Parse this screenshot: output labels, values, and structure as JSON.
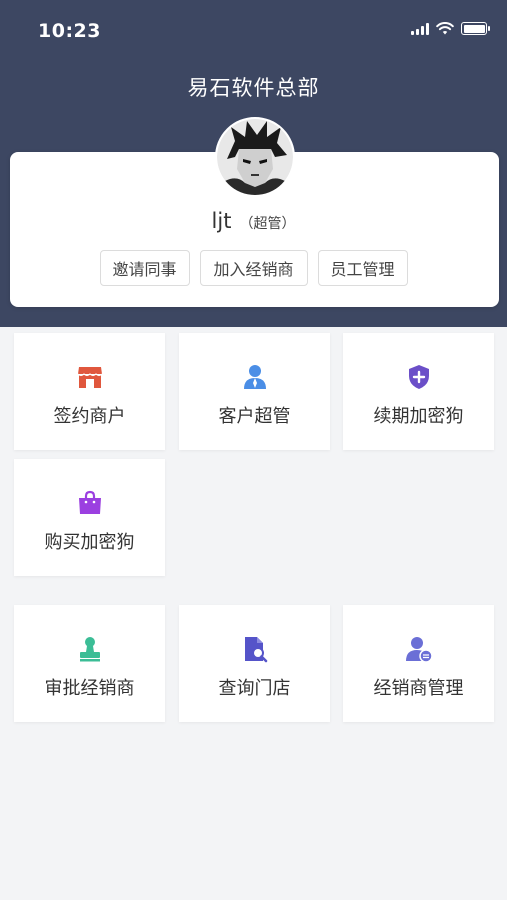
{
  "status_bar": {
    "time": "10:23"
  },
  "header": {
    "title": "易石软件总部"
  },
  "profile": {
    "username": "ljt",
    "role": "（超管）",
    "actions": [
      {
        "label": "邀请同事"
      },
      {
        "label": "加入经销商"
      },
      {
        "label": "员工管理"
      }
    ]
  },
  "section1": {
    "tiles": [
      {
        "label": "签约商户",
        "icon": "store-icon",
        "color": "#e0573d"
      },
      {
        "label": "客户超管",
        "icon": "user-badge-icon",
        "color": "#4b8ee6"
      },
      {
        "label": "续期加密狗",
        "icon": "shield-plus-icon",
        "color": "#6b4fc8"
      },
      {
        "label": "购买加密狗",
        "icon": "shopping-bag-icon",
        "color": "#9b3fe0"
      }
    ]
  },
  "section2": {
    "tiles": [
      {
        "label": "审批经销商",
        "icon": "stamp-icon",
        "color": "#3bbd96"
      },
      {
        "label": "查询门店",
        "icon": "document-search-icon",
        "color": "#5554c9"
      },
      {
        "label": "经销商管理",
        "icon": "user-settings-icon",
        "color": "#6b6fd6"
      }
    ]
  }
}
